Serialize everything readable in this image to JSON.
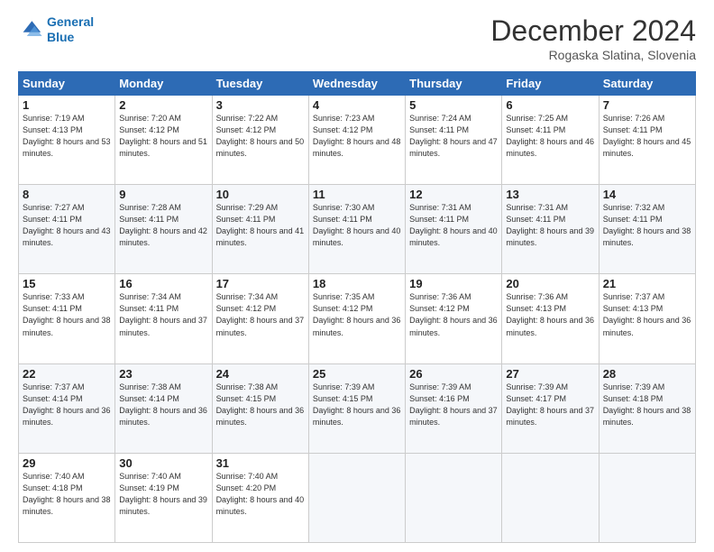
{
  "logo": {
    "line1": "General",
    "line2": "Blue"
  },
  "title": "December 2024",
  "subtitle": "Rogaska Slatina, Slovenia",
  "header_days": [
    "Sunday",
    "Monday",
    "Tuesday",
    "Wednesday",
    "Thursday",
    "Friday",
    "Saturday"
  ],
  "weeks": [
    [
      {
        "day": "1",
        "sunrise": "Sunrise: 7:19 AM",
        "sunset": "Sunset: 4:13 PM",
        "daylight": "Daylight: 8 hours and 53 minutes."
      },
      {
        "day": "2",
        "sunrise": "Sunrise: 7:20 AM",
        "sunset": "Sunset: 4:12 PM",
        "daylight": "Daylight: 8 hours and 51 minutes."
      },
      {
        "day": "3",
        "sunrise": "Sunrise: 7:22 AM",
        "sunset": "Sunset: 4:12 PM",
        "daylight": "Daylight: 8 hours and 50 minutes."
      },
      {
        "day": "4",
        "sunrise": "Sunrise: 7:23 AM",
        "sunset": "Sunset: 4:12 PM",
        "daylight": "Daylight: 8 hours and 48 minutes."
      },
      {
        "day": "5",
        "sunrise": "Sunrise: 7:24 AM",
        "sunset": "Sunset: 4:11 PM",
        "daylight": "Daylight: 8 hours and 47 minutes."
      },
      {
        "day": "6",
        "sunrise": "Sunrise: 7:25 AM",
        "sunset": "Sunset: 4:11 PM",
        "daylight": "Daylight: 8 hours and 46 minutes."
      },
      {
        "day": "7",
        "sunrise": "Sunrise: 7:26 AM",
        "sunset": "Sunset: 4:11 PM",
        "daylight": "Daylight: 8 hours and 45 minutes."
      }
    ],
    [
      {
        "day": "8",
        "sunrise": "Sunrise: 7:27 AM",
        "sunset": "Sunset: 4:11 PM",
        "daylight": "Daylight: 8 hours and 43 minutes."
      },
      {
        "day": "9",
        "sunrise": "Sunrise: 7:28 AM",
        "sunset": "Sunset: 4:11 PM",
        "daylight": "Daylight: 8 hours and 42 minutes."
      },
      {
        "day": "10",
        "sunrise": "Sunrise: 7:29 AM",
        "sunset": "Sunset: 4:11 PM",
        "daylight": "Daylight: 8 hours and 41 minutes."
      },
      {
        "day": "11",
        "sunrise": "Sunrise: 7:30 AM",
        "sunset": "Sunset: 4:11 PM",
        "daylight": "Daylight: 8 hours and 40 minutes."
      },
      {
        "day": "12",
        "sunrise": "Sunrise: 7:31 AM",
        "sunset": "Sunset: 4:11 PM",
        "daylight": "Daylight: 8 hours and 40 minutes."
      },
      {
        "day": "13",
        "sunrise": "Sunrise: 7:31 AM",
        "sunset": "Sunset: 4:11 PM",
        "daylight": "Daylight: 8 hours and 39 minutes."
      },
      {
        "day": "14",
        "sunrise": "Sunrise: 7:32 AM",
        "sunset": "Sunset: 4:11 PM",
        "daylight": "Daylight: 8 hours and 38 minutes."
      }
    ],
    [
      {
        "day": "15",
        "sunrise": "Sunrise: 7:33 AM",
        "sunset": "Sunset: 4:11 PM",
        "daylight": "Daylight: 8 hours and 38 minutes."
      },
      {
        "day": "16",
        "sunrise": "Sunrise: 7:34 AM",
        "sunset": "Sunset: 4:11 PM",
        "daylight": "Daylight: 8 hours and 37 minutes."
      },
      {
        "day": "17",
        "sunrise": "Sunrise: 7:34 AM",
        "sunset": "Sunset: 4:12 PM",
        "daylight": "Daylight: 8 hours and 37 minutes."
      },
      {
        "day": "18",
        "sunrise": "Sunrise: 7:35 AM",
        "sunset": "Sunset: 4:12 PM",
        "daylight": "Daylight: 8 hours and 36 minutes."
      },
      {
        "day": "19",
        "sunrise": "Sunrise: 7:36 AM",
        "sunset": "Sunset: 4:12 PM",
        "daylight": "Daylight: 8 hours and 36 minutes."
      },
      {
        "day": "20",
        "sunrise": "Sunrise: 7:36 AM",
        "sunset": "Sunset: 4:13 PM",
        "daylight": "Daylight: 8 hours and 36 minutes."
      },
      {
        "day": "21",
        "sunrise": "Sunrise: 7:37 AM",
        "sunset": "Sunset: 4:13 PM",
        "daylight": "Daylight: 8 hours and 36 minutes."
      }
    ],
    [
      {
        "day": "22",
        "sunrise": "Sunrise: 7:37 AM",
        "sunset": "Sunset: 4:14 PM",
        "daylight": "Daylight: 8 hours and 36 minutes."
      },
      {
        "day": "23",
        "sunrise": "Sunrise: 7:38 AM",
        "sunset": "Sunset: 4:14 PM",
        "daylight": "Daylight: 8 hours and 36 minutes."
      },
      {
        "day": "24",
        "sunrise": "Sunrise: 7:38 AM",
        "sunset": "Sunset: 4:15 PM",
        "daylight": "Daylight: 8 hours and 36 minutes."
      },
      {
        "day": "25",
        "sunrise": "Sunrise: 7:39 AM",
        "sunset": "Sunset: 4:15 PM",
        "daylight": "Daylight: 8 hours and 36 minutes."
      },
      {
        "day": "26",
        "sunrise": "Sunrise: 7:39 AM",
        "sunset": "Sunset: 4:16 PM",
        "daylight": "Daylight: 8 hours and 37 minutes."
      },
      {
        "day": "27",
        "sunrise": "Sunrise: 7:39 AM",
        "sunset": "Sunset: 4:17 PM",
        "daylight": "Daylight: 8 hours and 37 minutes."
      },
      {
        "day": "28",
        "sunrise": "Sunrise: 7:39 AM",
        "sunset": "Sunset: 4:18 PM",
        "daylight": "Daylight: 8 hours and 38 minutes."
      }
    ],
    [
      {
        "day": "29",
        "sunrise": "Sunrise: 7:40 AM",
        "sunset": "Sunset: 4:18 PM",
        "daylight": "Daylight: 8 hours and 38 minutes."
      },
      {
        "day": "30",
        "sunrise": "Sunrise: 7:40 AM",
        "sunset": "Sunset: 4:19 PM",
        "daylight": "Daylight: 8 hours and 39 minutes."
      },
      {
        "day": "31",
        "sunrise": "Sunrise: 7:40 AM",
        "sunset": "Sunset: 4:20 PM",
        "daylight": "Daylight: 8 hours and 40 minutes."
      },
      null,
      null,
      null,
      null
    ]
  ]
}
